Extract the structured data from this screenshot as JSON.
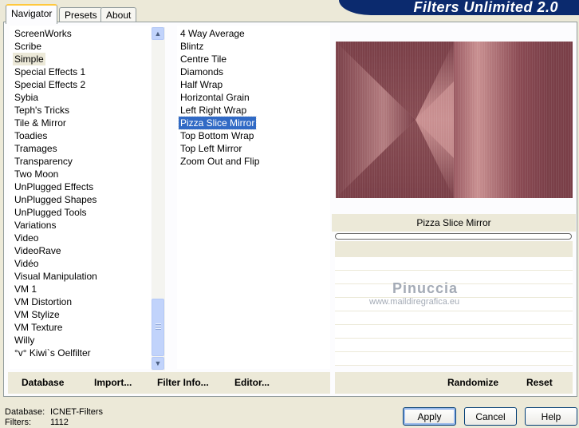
{
  "brand": {
    "title": "Filters Unlimited 2.0"
  },
  "tabs": [
    {
      "label": "Navigator",
      "active": true
    },
    {
      "label": "Presets",
      "active": false
    },
    {
      "label": "About",
      "active": false
    }
  ],
  "categories": {
    "items": [
      "ScreenWorks",
      "Scribe",
      "Simple",
      "Special Effects 1",
      "Special Effects 2",
      "Sybia",
      "Teph's Tricks",
      "Tile & Mirror",
      "Toadies",
      "Tramages",
      "Transparency",
      "Two Moon",
      "UnPlugged Effects",
      "UnPlugged Shapes",
      "UnPlugged Tools",
      "Variations",
      "Video",
      "VideoRave",
      "Vidéo",
      "Visual Manipulation",
      "VM 1",
      "VM Distortion",
      "VM Stylize",
      "VM Texture",
      "Willy",
      "°v° Kiwi`s Oelfilter"
    ],
    "selected": "Simple"
  },
  "filters": {
    "items": [
      "4 Way Average",
      "Blintz",
      "Centre Tile",
      "Diamonds",
      "Half Wrap",
      "Horizontal Grain",
      "Left Right Wrap",
      "Pizza Slice Mirror",
      "Top Bottom Wrap",
      "Top Left Mirror",
      "Zoom Out and Flip"
    ],
    "selected": "Pizza Slice Mirror"
  },
  "left_buttons": {
    "database": "Database",
    "import": "Import...",
    "filter_info": "Filter Info...",
    "editor": "Editor..."
  },
  "right_buttons": {
    "randomize": "Randomize",
    "reset": "Reset"
  },
  "preview": {
    "filter_name": "Pizza Slice Mirror",
    "progress_fraction": 0,
    "colors": {
      "dark": "#7a3f48",
      "light": "#c99091"
    }
  },
  "watermark": {
    "name": "Pinuccia",
    "url": "www.maildiregrafica.eu"
  },
  "footer": {
    "database_label": "Database:",
    "database_value": "ICNET-Filters",
    "filters_label": "Filters:",
    "filters_value": "1112"
  },
  "dialog_buttons": {
    "apply": "Apply",
    "cancel": "Cancel",
    "help": "Help"
  },
  "scrollbar_icons": {
    "up": "chevron-up-icon",
    "down": "chevron-down-icon"
  }
}
